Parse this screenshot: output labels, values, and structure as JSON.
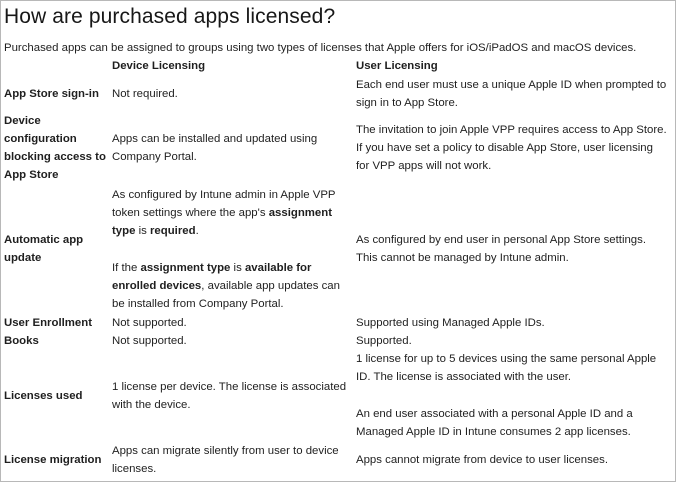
{
  "title": "How are purchased apps licensed?",
  "intro": "Purchased apps can be assigned to groups using two types of licenses that Apple offers for iOS/iPadOS and macOS devices.",
  "table": {
    "headers": [
      "Device Licensing",
      "User Licensing"
    ],
    "rows": {
      "app_store_signin": {
        "label": "App Store sign-in",
        "device": "Not required.",
        "user": "Each end user must use a unique Apple ID when prompted to sign in to App Store."
      },
      "device_config": {
        "label": "Device configuration blocking access to App Store",
        "device": "Apps can be installed and updated using Company Portal.",
        "user": "The invitation to join Apple VPP requires access to App Store. If you have set a policy to disable App Store, user licensing for VPP apps will not work."
      },
      "auto_update": {
        "label": "Automatic app update",
        "device_p1": {
          "t1": "As configured by Intune admin in Apple VPP token settings where the app's ",
          "b1": "assignment type",
          "t2": " is ",
          "b2": "required",
          "t3": "."
        },
        "device_p2": {
          "t1": "If the ",
          "b1": "assignment type",
          "t2": " is ",
          "b2": "available for enrolled devices",
          "t3": ", available app updates can be installed from Company Portal."
        },
        "user": "As configured by end user in personal App Store settings. This cannot be managed by Intune admin."
      },
      "user_enrollment": {
        "label": "User Enrollment",
        "device": "Not supported.",
        "user": "Supported using Managed Apple IDs."
      },
      "books": {
        "label": "Books",
        "device": "Not supported.",
        "user": "Supported."
      },
      "licenses_used": {
        "label": "Licenses used",
        "device": "1 license per device. The license is associated with the device.",
        "user_p1": "1 license for up to 5 devices using the same personal Apple ID. The license is associated with the user.",
        "user_p2": "An end user associated with a personal Apple ID and a Managed Apple ID in Intune consumes 2 app licenses."
      },
      "license_migration": {
        "label": "License migration",
        "device": "Apps can migrate silently from user to device licenses.",
        "user": "Apps cannot migrate from device to user licenses."
      }
    }
  }
}
